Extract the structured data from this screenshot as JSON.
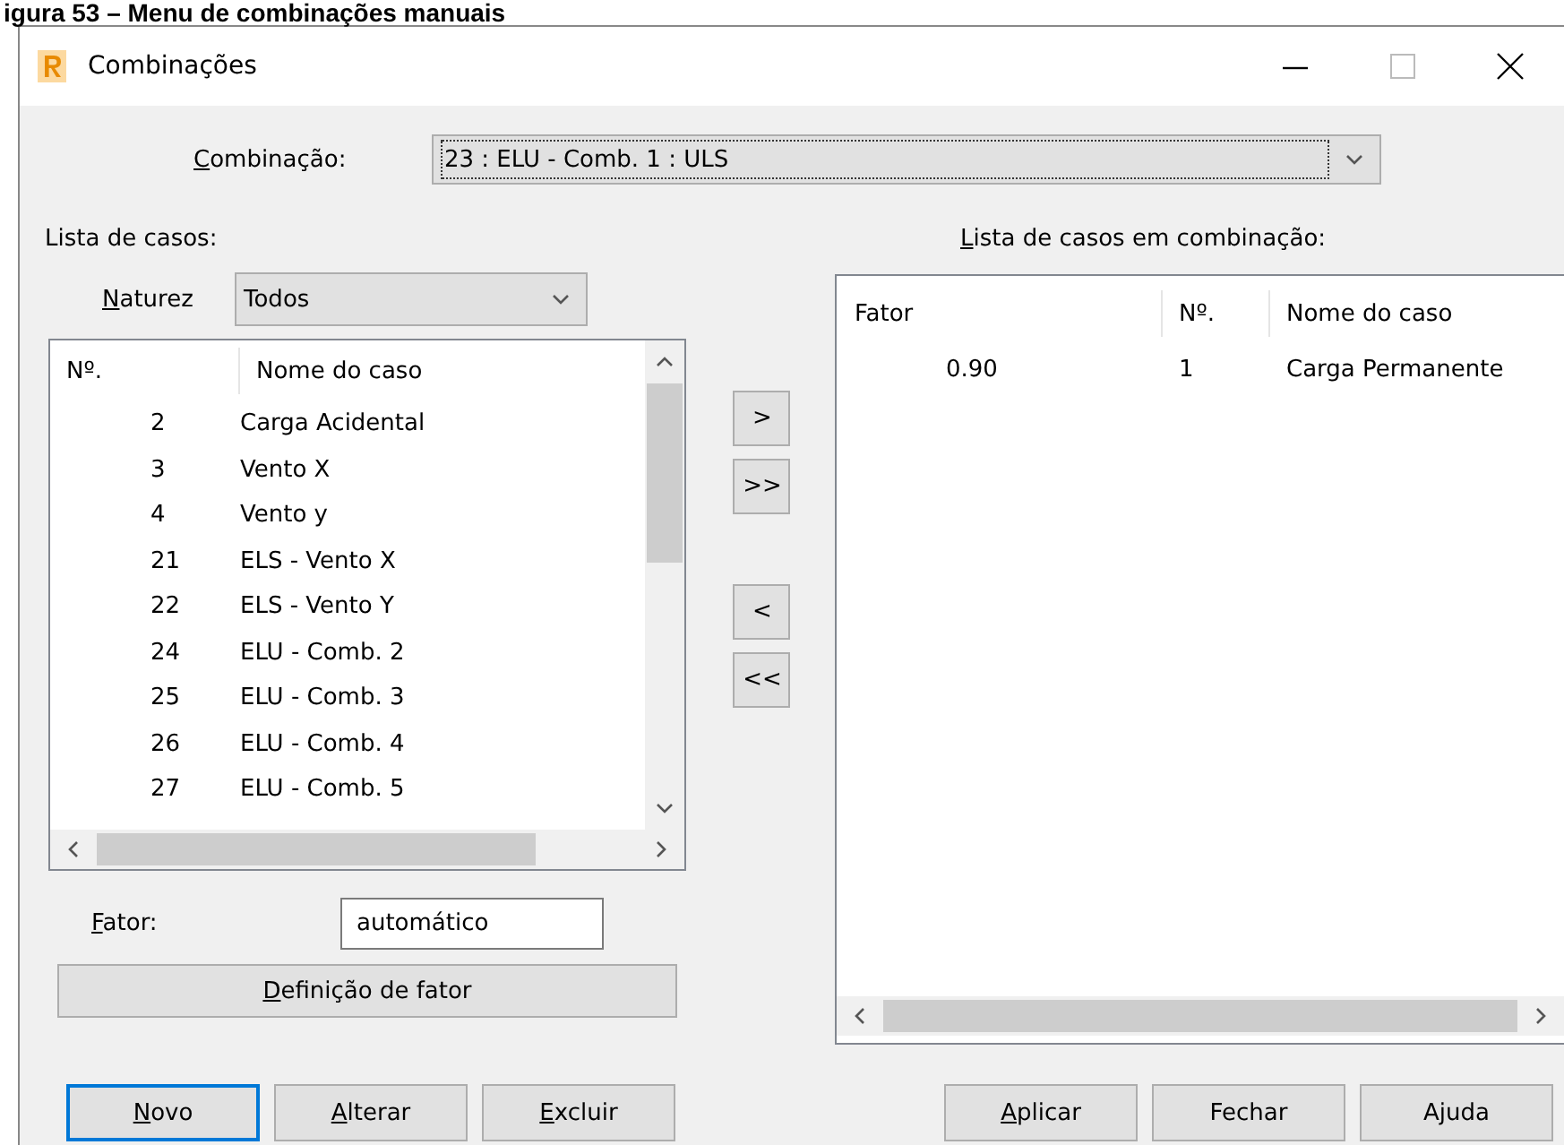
{
  "caption": "igura 53 – Menu de combinações manuais",
  "window": {
    "title": "Combinações"
  },
  "combination": {
    "label": "Combinação:",
    "mnemonic": true,
    "value": "23 : ELU - Comb. 1 : ULS"
  },
  "case_list": {
    "label": "Lista de casos:",
    "nature": {
      "label": "Naturez",
      "mnemonic": true,
      "value": "Todos"
    },
    "columns": [
      "Nº.",
      "Nome do caso"
    ],
    "rows": [
      {
        "no": "2",
        "name": "Carga Acidental"
      },
      {
        "no": "3",
        "name": "Vento X"
      },
      {
        "no": "4",
        "name": "Vento y"
      },
      {
        "no": "21",
        "name": "ELS - Vento X"
      },
      {
        "no": "22",
        "name": "ELS - Vento Y"
      },
      {
        "no": "24",
        "name": "ELU - Comb. 2"
      },
      {
        "no": "25",
        "name": "ELU - Comb. 3"
      },
      {
        "no": "26",
        "name": "ELU - Comb. 4"
      },
      {
        "no": "27",
        "name": "ELU - Comb. 5"
      }
    ]
  },
  "transfer_buttons": [
    ">",
    ">>",
    "<",
    "<<"
  ],
  "combination_cases": {
    "label": "Lista de casos em combinação:",
    "mnemonic": true,
    "columns": [
      "Fator",
      "Nº.",
      "Nome do caso"
    ],
    "rows": [
      {
        "factor": "0.90",
        "no": "1",
        "name": "Carga Permanente"
      }
    ]
  },
  "factor": {
    "label": "Fator:",
    "mnemonic": true,
    "value": "automático"
  },
  "factor_button": {
    "label": "Definição de fator",
    "mnemonic": true
  },
  "left_buttons": [
    {
      "label": "Novo",
      "mnemonic": true,
      "default": true
    },
    {
      "label": "Alterar",
      "mnemonic": true,
      "default": false
    },
    {
      "label": "Excluir",
      "mnemonic": true,
      "default": false
    }
  ],
  "right_buttons": [
    {
      "label": "Aplicar",
      "mnemonic": true,
      "default": false
    },
    {
      "label": "Fechar",
      "mnemonic": false,
      "default": false
    },
    {
      "label": "Ajuda",
      "mnemonic": false,
      "default": false
    }
  ]
}
